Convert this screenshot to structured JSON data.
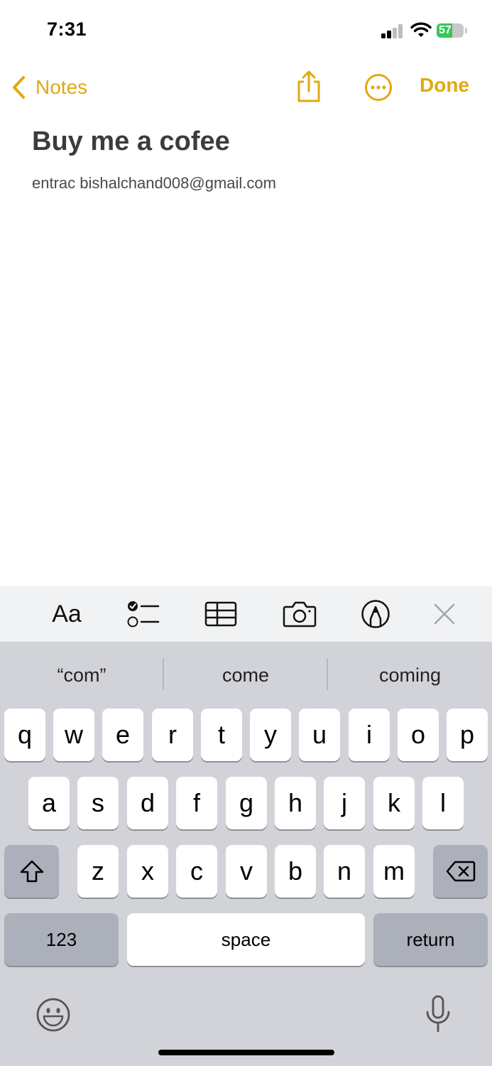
{
  "status_bar": {
    "time": "7:31",
    "battery_percent": "57",
    "battery_level": 0.57
  },
  "nav": {
    "back_label": "Notes",
    "done_label": "Done"
  },
  "note": {
    "title": "Buy me a cofee",
    "body": "entrac bishalchand008@gmail.com"
  },
  "toolbar": {
    "format_label": "Aa"
  },
  "keyboard": {
    "suggestions": [
      "“com”",
      "come",
      "coming"
    ],
    "row1": [
      "q",
      "w",
      "e",
      "r",
      "t",
      "y",
      "u",
      "i",
      "o",
      "p"
    ],
    "row2": [
      "a",
      "s",
      "d",
      "f",
      "g",
      "h",
      "j",
      "k",
      "l"
    ],
    "row3": [
      "z",
      "x",
      "c",
      "v",
      "b",
      "n",
      "m"
    ],
    "numbers_label": "123",
    "space_label": "space",
    "return_label": "return"
  },
  "colors": {
    "accent": "#e1a90f",
    "battery_green": "#34c759",
    "keyboard_bg": "#d1d3d9"
  },
  "icons": [
    "back-chevron-icon",
    "share-icon",
    "more-icon",
    "checklist-icon",
    "table-icon",
    "camera-icon",
    "markup-icon",
    "close-icon",
    "shift-icon",
    "delete-icon",
    "emoji-icon",
    "microphone-icon"
  ]
}
